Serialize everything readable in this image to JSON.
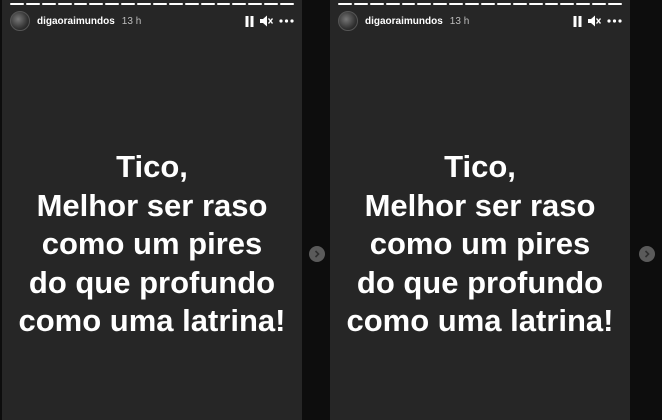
{
  "stories": [
    {
      "segments_total": 18,
      "segments_viewed": 18,
      "username": "digaoraimundos",
      "time": "13 h",
      "icons": {
        "pause": "pause-icon",
        "mute": "speaker-muted-icon",
        "more": "more-options-icon"
      },
      "message": [
        "Tico,",
        "Melhor ser raso",
        "como um pires",
        "do que profundo",
        "como uma latrina!"
      ]
    },
    {
      "segments_total": 18,
      "segments_viewed": 18,
      "username": "digaoraimundos",
      "time": "13 h",
      "icons": {
        "pause": "pause-icon",
        "mute": "speaker-muted-icon",
        "more": "more-options-icon"
      },
      "message": [
        "Tico,",
        "Melhor ser raso",
        "como um pires",
        "do que profundo",
        "como uma latrina!"
      ]
    }
  ],
  "next_arrow_icon": "chevron-right-icon",
  "colors": {
    "story_bg": "#262626",
    "gap_bg": "#0d0d0d",
    "text": "#ffffff"
  }
}
